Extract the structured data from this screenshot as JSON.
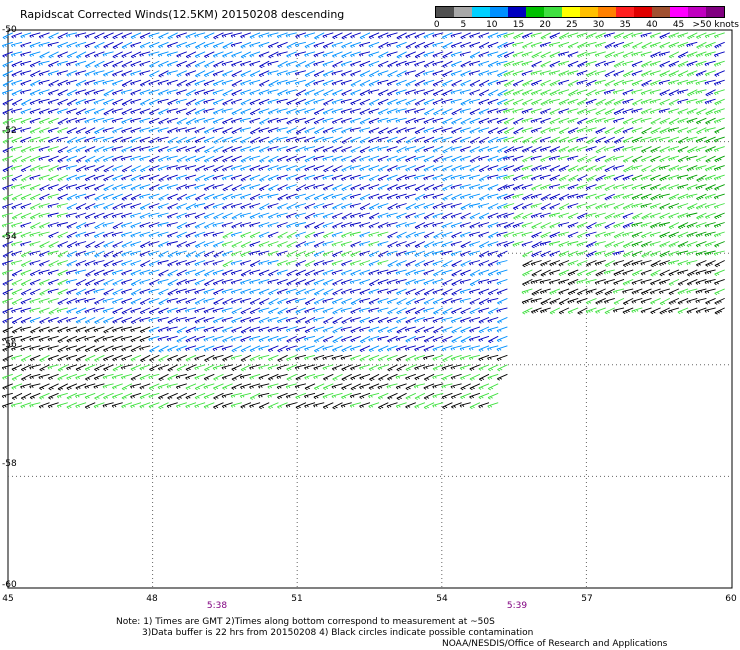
{
  "title": "Rapidscat Corrected Winds(12.5KM) 20150208 descending",
  "colorbar": {
    "colors": [
      "#505050",
      "#a8a8a8",
      "#00d0ff",
      "#0090ff",
      "#0000c0",
      "#00c000",
      "#40e040",
      "#ffff00",
      "#ffc000",
      "#ff8000",
      "#ff2020",
      "#e00000",
      "#a05030",
      "#ff00ff",
      "#c000c0",
      "#800080"
    ],
    "labels": [
      "0",
      "5",
      "10",
      "15",
      "20",
      "25",
      "30",
      "35",
      "40",
      "45",
      ">50 knots"
    ]
  },
  "axes": {
    "x_ticks": [
      "45",
      "48",
      "51",
      "54",
      "57",
      "60"
    ],
    "y_ticks": [
      "-50",
      "-52",
      "-54",
      "-56",
      "-58",
      "-60"
    ],
    "time_labels": [
      "5:38",
      "5:39"
    ]
  },
  "notes": {
    "line1": "Note: 1) Times are GMT 2)Times along bottom correspond to measurement at ~50S",
    "line2": "3)Data buffer is 22 hrs from 20150208 4) Black circles indicate possible contamination",
    "credit": "NOAA/NESDIS/Office of Research and Applications"
  },
  "map_data": {
    "extent": {
      "lon": [
        45,
        60
      ],
      "lat": [
        -60,
        -50
      ]
    },
    "wind_speed_units": "knots",
    "swath_regions": [
      {
        "name": "west-swath",
        "lon": [
          45,
          55.5
        ],
        "lat": [
          -56.8,
          -50
        ],
        "dominant_speed_knots": [
          15,
          20
        ]
      },
      {
        "name": "east-swath",
        "lon": [
          55.5,
          60
        ],
        "lat": [
          -55,
          -50
        ],
        "dominant_speed_knots": [
          20,
          25
        ]
      }
    ]
  }
}
